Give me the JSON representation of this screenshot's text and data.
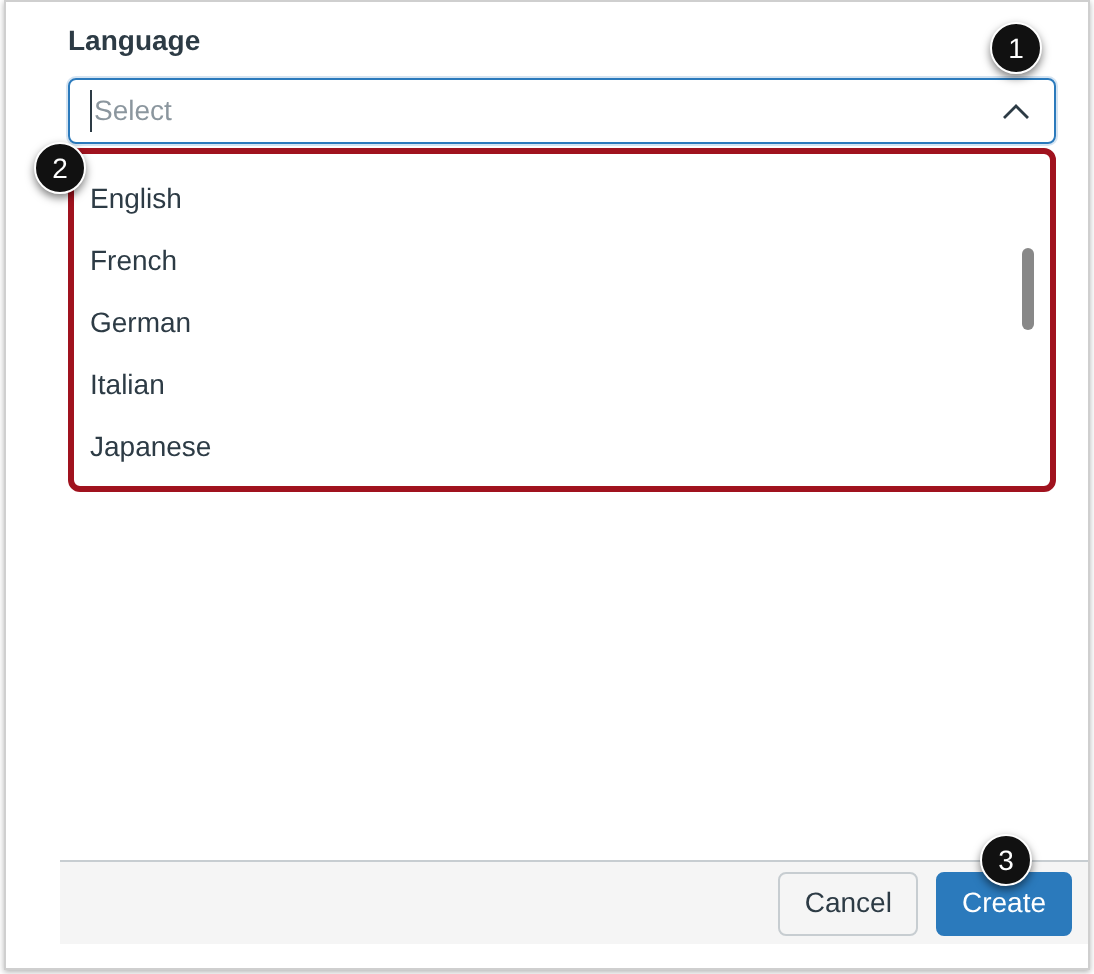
{
  "field": {
    "label": "Language",
    "placeholder": "Select",
    "expanded": true
  },
  "options": [
    {
      "label": "English"
    },
    {
      "label": "French"
    },
    {
      "label": "German"
    },
    {
      "label": "Italian"
    },
    {
      "label": "Japanese"
    }
  ],
  "buttons": [
    {
      "label": "Cancel",
      "kind": "secondary"
    },
    {
      "label": "Create",
      "kind": "primary"
    }
  ],
  "callouts": [
    "1",
    "2",
    "3"
  ]
}
